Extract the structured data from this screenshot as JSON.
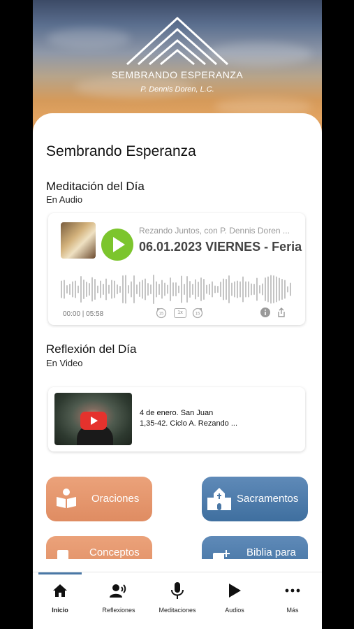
{
  "header": {
    "brand": "SEMBRANDO ESPERANZA",
    "author": "P. Dennis Doren, L.C."
  },
  "main": {
    "title": "Sembrando Esperanza",
    "meditation": {
      "title": "Meditación del Día",
      "subtitle": "En Audio",
      "player": {
        "show": "Rezando Juntos, con P. Dennis Doren ...",
        "episode": "06.01.2023 VIERNES - Feria",
        "time": "00:00 | 05:58",
        "speed": "1x",
        "rewind": "15",
        "forward": "15"
      }
    },
    "reflection": {
      "title": "Reflexión del Día",
      "subtitle": "En Video",
      "video_line1": "4 de enero.  San Juan",
      "video_line2": "1,35-42. Ciclo A. Rezando ..."
    },
    "tiles": {
      "oraciones": "Oraciones",
      "sacramentos": "Sacramentos",
      "conceptos": "Conceptos",
      "biblia": "Biblia para"
    }
  },
  "nav": {
    "items": [
      "Inicio",
      "Reflexiones",
      "Meditaciones",
      "Audios",
      "Más"
    ],
    "active": "Inicio"
  },
  "colors": {
    "accent_green": "#7cc52d",
    "tile_orange": "#df8c62",
    "tile_blue": "#3f6f9f",
    "youtube_red": "#e5322d"
  }
}
